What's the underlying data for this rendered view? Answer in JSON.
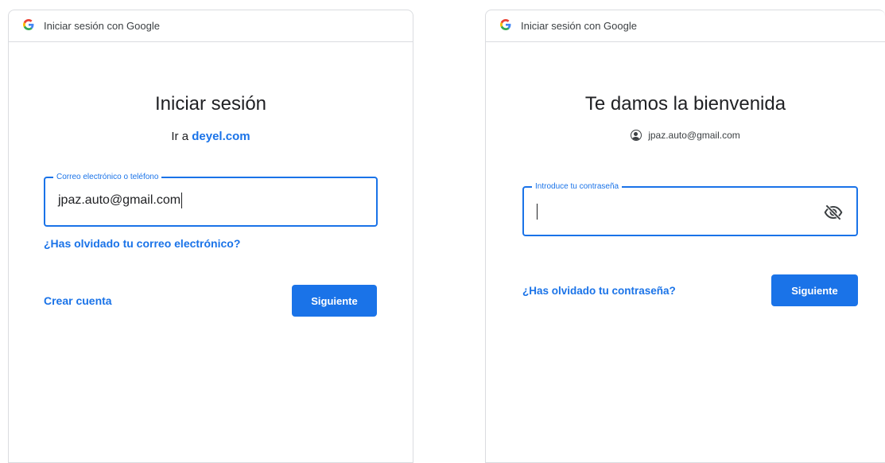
{
  "left": {
    "window_title": "Iniciar sesión con Google",
    "heading": "Iniciar sesión",
    "subtitle_prefix": "Ir a",
    "subtitle_domain": "deyel.com",
    "email_field": {
      "label": "Correo electrónico o teléfono",
      "value": "jpaz.auto@gmail.com"
    },
    "forgot_email_link": "¿Has olvidado tu correo electrónico?",
    "create_account_link": "Crear cuenta",
    "next_button": "Siguiente"
  },
  "right": {
    "window_title": "Iniciar sesión con Google",
    "heading": "Te damos la bienvenida",
    "account_email": "jpaz.auto@gmail.com",
    "password_field": {
      "label": "Introduce tu contraseña",
      "value": ""
    },
    "forgot_password_link": "¿Has olvidado tu contraseña?",
    "next_button": "Siguiente"
  },
  "icons": {
    "google": "google-g-icon",
    "account": "account-circle-icon",
    "visibility": "visibility-off-icon"
  },
  "colors": {
    "accent": "#1a73e8",
    "border": "#dadce0",
    "text": "#202124"
  }
}
